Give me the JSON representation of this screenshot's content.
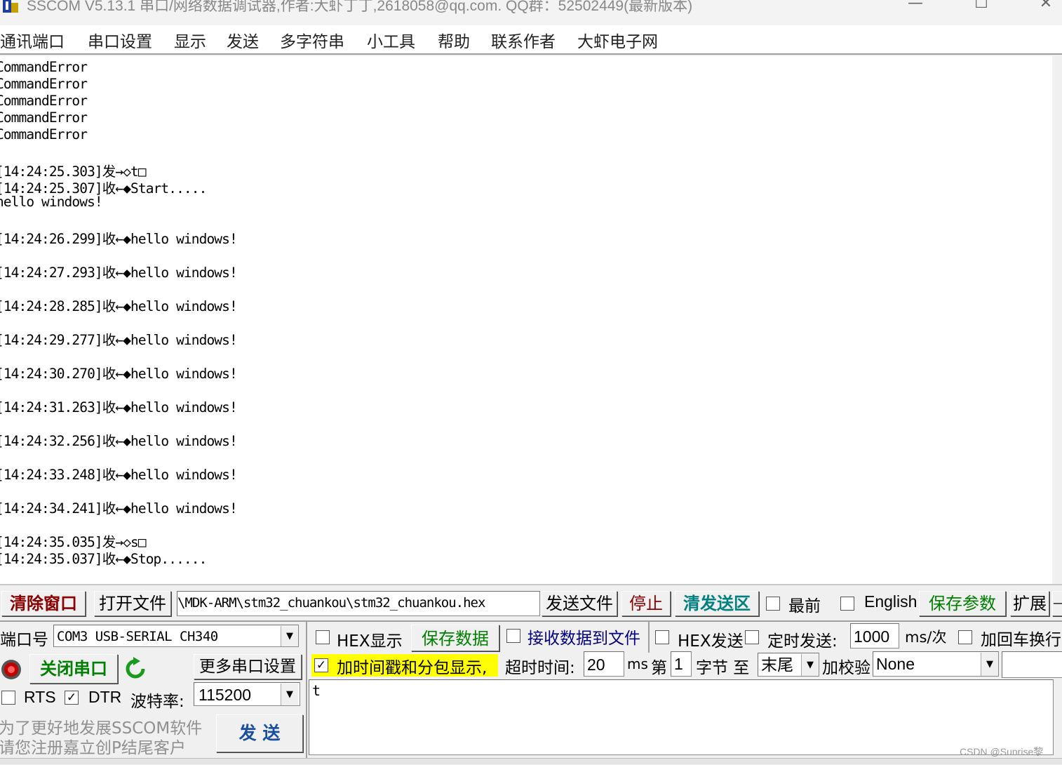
{
  "window": {
    "title": "SSCOM V5.13.1 串口/网络数据调试器,作者:大虾丁丁,2618058@qq.com. QQ群：52502449(最新版本)",
    "minimize_glyph": "—",
    "maximize_glyph": "☐",
    "close_glyph": "✕"
  },
  "menu": [
    "通讯端口",
    "串口设置",
    "显示",
    "发送",
    "多字符串",
    "小工具",
    "帮助",
    "联系作者",
    "大虾电子网"
  ],
  "receive": {
    "lines": [
      "CommandError",
      "CommandError",
      "CommandError",
      "CommandError",
      "CommandError",
      "",
      "[14:24:25.303]发→◇t□",
      "[14:24:25.307]收←◆Start.....",
      "hello windows!",
      "",
      "[14:24:26.299]收←◆hello windows!",
      "",
      "[14:24:27.293]收←◆hello windows!",
      "",
      "[14:24:28.285]收←◆hello windows!",
      "",
      "[14:24:29.277]收←◆hello windows!",
      "",
      "[14:24:30.270]收←◆hello windows!",
      "",
      "[14:24:31.263]收←◆hello windows!",
      "",
      "[14:24:32.256]收←◆hello windows!",
      "",
      "[14:24:33.248]收←◆hello windows!",
      "",
      "[14:24:34.241]收←◆hello windows!",
      "",
      "[14:24:35.035]发→◇s□",
      "[14:24:35.037]收←◆Stop......"
    ]
  },
  "row1": {
    "clear_window": "清除窗口",
    "open_file": "打开文件",
    "file_path": "\\MDK-ARM\\stm32_chuankou\\stm32_chuankou.hex",
    "send_file": "发送文件",
    "stop": "停止",
    "clear_send": "清发送区",
    "topmost_label": "最前",
    "topmost_checked": false,
    "english_label": "English",
    "english_checked": false,
    "save_params": "保存参数",
    "expand": "扩展",
    "dash": "—"
  },
  "port": {
    "port_label": "端口号",
    "port_value": "COM3 USB-SERIAL CH340",
    "close_port": "关闭串口",
    "more_settings": "更多串口设置",
    "rts_label": "RTS",
    "rts_checked": false,
    "dtr_label": "DTR",
    "dtr_checked": true,
    "baud_label": "波特率:",
    "baud_value": "115200",
    "promo_line1": "为了更好地发展SSCOM软件",
    "promo_line2": "请您注册嘉立创P结尾客户",
    "send_button": "发  送"
  },
  "options": {
    "hex_display_label": "HEX显示",
    "hex_display_checked": false,
    "save_data": "保存数据",
    "recv_to_file_label": "接收数据到文件",
    "recv_to_file_checked": false,
    "hex_send_label": "HEX发送",
    "hex_send_checked": false,
    "timed_send_label": "定时发送:",
    "timed_send_checked": false,
    "interval_value": "1000",
    "interval_unit": "ms/次",
    "add_crlf_label": "加回车换行",
    "add_crlf_checked": false,
    "timestamp_label": "加时间戳和分包显示,",
    "timestamp_checked": true,
    "timeout_label": "超时时间:",
    "timeout_value": "20",
    "timeout_unit": "ms",
    "byte_from_label": "第",
    "byte_from_value": "1",
    "byte_to_label": "字节 至",
    "byte_to_value": "末尾",
    "checksum_label": "加校验",
    "checksum_value": "None"
  },
  "send_box": {
    "text": "t"
  },
  "footer": {
    "watermark": "CSDN @Sunrise黎"
  },
  "colors": {
    "accent_red": "#8b0000",
    "accent_green": "#008000",
    "accent_blue": "#000080",
    "highlight_yellow": "#ffff00"
  }
}
